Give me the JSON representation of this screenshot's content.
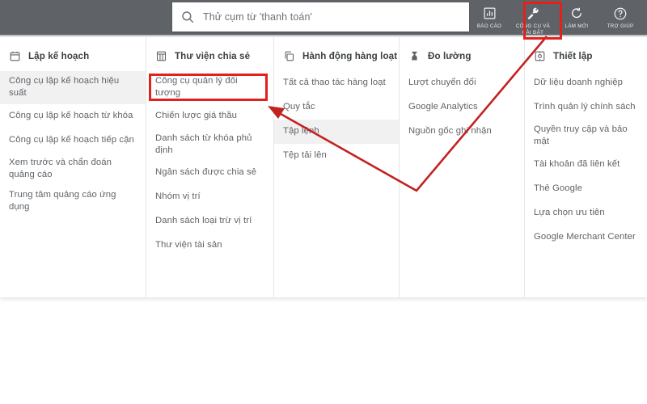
{
  "topbar": {
    "background_color": "#5f6368",
    "search": {
      "placeholder": "Thử cụm từ 'thanh toán'",
      "value": "",
      "icon": "search-icon"
    },
    "actions": [
      {
        "label": "BÁO CÁO",
        "icon": "bar-chart-box-icon"
      },
      {
        "label": "CÔNG CỤ VÀ CÀI ĐẶT",
        "icon": "wrench-icon",
        "highlighted": true
      },
      {
        "label": "LÀM MỚI",
        "icon": "refresh-icon"
      },
      {
        "label": "TRỢ GIÚP",
        "icon": "help-circle-icon"
      }
    ]
  },
  "annotations": {
    "highlight_color": "#e0211c",
    "arrow_label": "arrow from tools-and-settings to audience-manager",
    "boxes": [
      "tools-and-settings-button",
      "audience-manager-item"
    ]
  },
  "panel": {
    "columns": [
      {
        "title": "Lập kế hoạch",
        "icon": "calendar-icon",
        "items": [
          {
            "label": "Công cụ lập kế hoạch hiệu suất",
            "highlighted": true
          },
          {
            "label": "Công cụ lập kế hoạch từ khóa"
          },
          {
            "label": "Công cụ lập kế hoạch tiếp cận"
          },
          {
            "label": "Xem trước và chẩn đoán quảng cáo"
          },
          {
            "label": "Trung tâm quảng cáo ứng dụng"
          }
        ]
      },
      {
        "title": "Thư viện chia sẻ",
        "icon": "library-grid-icon",
        "items": [
          {
            "label": "Công cụ quản lý đối tượng",
            "boxed": true
          },
          {
            "label": "Chiến lược giá thầu"
          },
          {
            "label": "Danh sách từ khóa phủ định"
          },
          {
            "label": "Ngân sách được chia sẻ"
          },
          {
            "label": "Nhóm vị trí"
          },
          {
            "label": "Danh sách loại trừ vị trí"
          },
          {
            "label": "Thư viện tài sản"
          }
        ]
      },
      {
        "title": "Hành động hàng loạt",
        "icon": "copy-stack-icon",
        "items": [
          {
            "label": "Tất cả thao tác hàng loạt"
          },
          {
            "label": "Quy tắc"
          },
          {
            "label": "Tập lệnh",
            "highlighted": true
          },
          {
            "label": "Tệp tải lên"
          }
        ]
      },
      {
        "title": "Đo lường",
        "icon": "hourglass-icon",
        "items": [
          {
            "label": "Lượt chuyển đổi"
          },
          {
            "label": "Google Analytics"
          },
          {
            "label": "Nguồn gốc ghi nhận"
          }
        ]
      },
      {
        "title": "Thiết lập",
        "icon": "settings-frame-icon",
        "items": [
          {
            "label": "Dữ liệu doanh nghiệp"
          },
          {
            "label": "Trình quản lý chính sách"
          },
          {
            "label": "Quyền truy cập và bảo mật"
          },
          {
            "label": "Tài khoản đã liên kết"
          },
          {
            "label": "Thẻ Google"
          },
          {
            "label": "Lựa chọn ưu tiên"
          },
          {
            "label": "Google Merchant Center"
          }
        ]
      }
    ]
  }
}
